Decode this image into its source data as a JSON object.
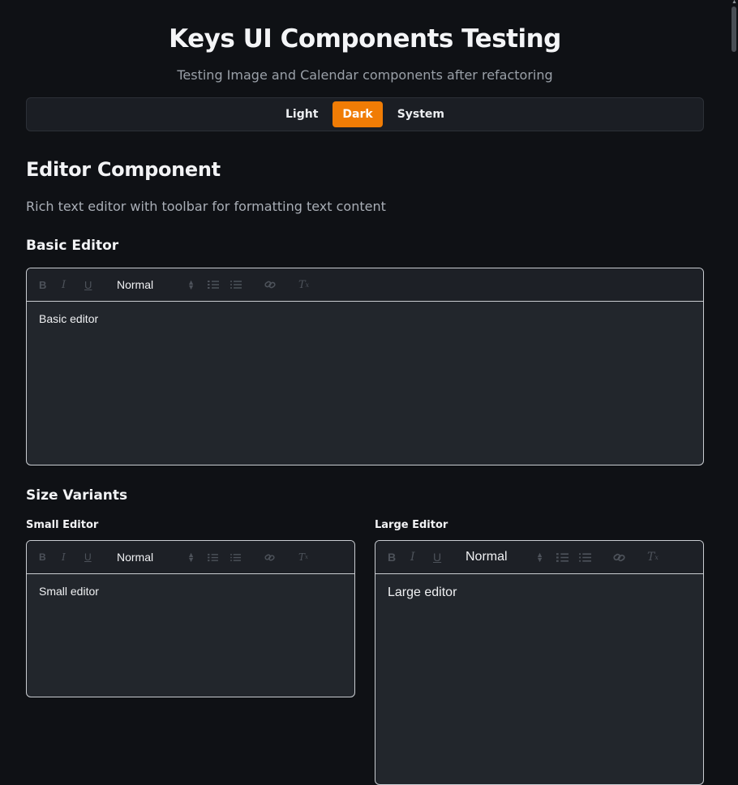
{
  "page": {
    "title": "Keys UI Components Testing",
    "subtitle": "Testing Image and Calendar components after refactoring"
  },
  "theme_switcher": {
    "options": [
      "Light",
      "Dark",
      "System"
    ],
    "selected": "Dark",
    "accent_color": "#f07c05"
  },
  "section": {
    "title": "Editor Component",
    "description": "Rich text editor with toolbar for formatting text content"
  },
  "basic": {
    "heading": "Basic Editor",
    "editor": {
      "format_value": "Normal",
      "content": "Basic editor"
    }
  },
  "sizes": {
    "heading": "Size Variants",
    "small": {
      "label": "Small Editor",
      "format_value": "Normal",
      "content": "Small editor"
    },
    "large": {
      "label": "Large Editor",
      "format_value": "Normal",
      "content": "Large editor"
    }
  },
  "toolbar_icons": [
    "bold-icon",
    "italic-icon",
    "underline-icon",
    "ordered-list-icon",
    "bullet-list-icon",
    "link-icon",
    "clear-format-icon"
  ]
}
